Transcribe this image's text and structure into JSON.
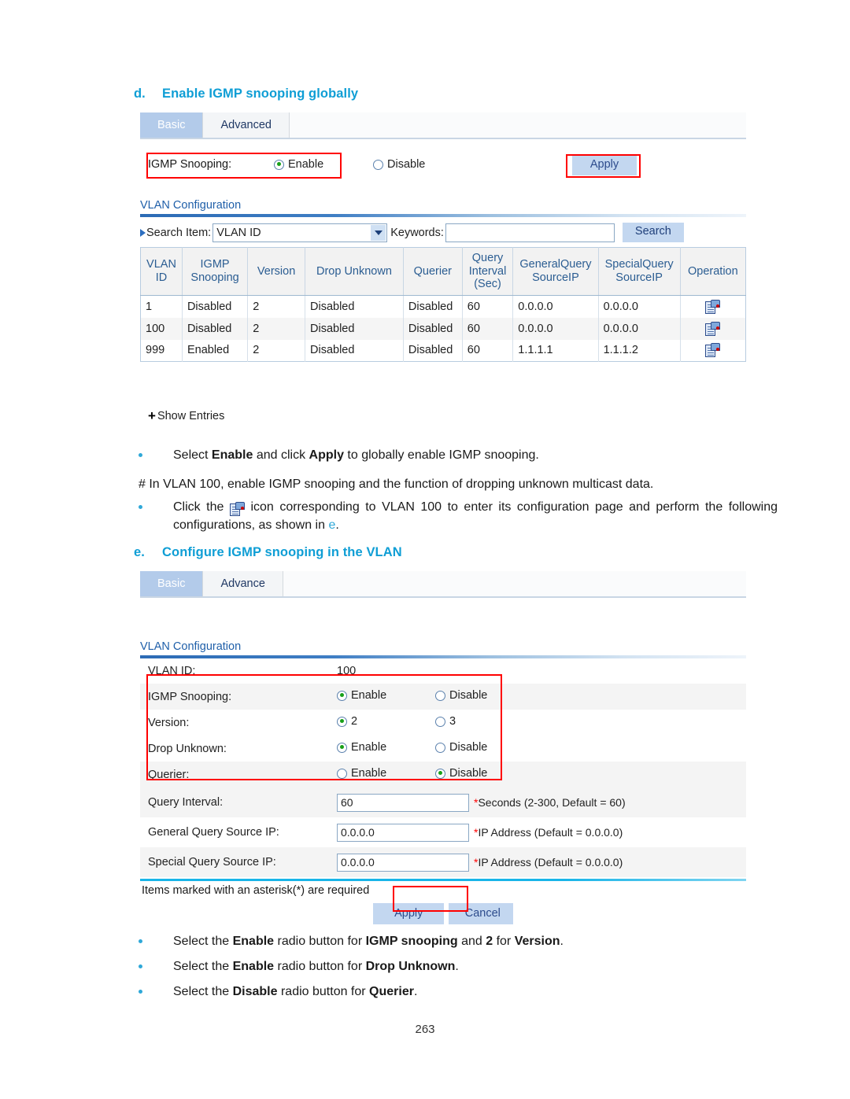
{
  "section_d": {
    "letter": "d.",
    "title": "Enable IGMP snooping globally"
  },
  "panel1": {
    "tabs": [
      {
        "label": "Basic",
        "active": true
      },
      {
        "label": "Advanced",
        "active": false
      }
    ],
    "igmp_snooping_label": "IGMP Snooping:",
    "enable_label": "Enable",
    "disable_label": "Disable",
    "apply_label": "Apply",
    "section_title": "VLAN Configuration",
    "search": {
      "search_item_label": "Search Item:",
      "selected_option": "VLAN ID",
      "options": [
        "VLAN ID"
      ],
      "keywords_label": "Keywords:",
      "keywords_value": "",
      "search_button": "Search"
    },
    "table": {
      "headers": [
        "VLAN ID",
        "IGMP Snooping",
        "Version",
        "Drop Unknown",
        "Querier",
        "Query Interval (Sec)",
        "GeneralQuery SourceIP",
        "SpecialQuery SourceIP",
        "Operation"
      ],
      "rows": [
        {
          "vlan_id": "1",
          "igmp_snooping": "Disabled",
          "version": "2",
          "drop_unknown": "Disabled",
          "querier": "Disabled",
          "query_interval": "60",
          "general_query_source_ip": "0.0.0.0",
          "special_query_source_ip": "0.0.0.0",
          "operation_icon": "config-icon"
        },
        {
          "vlan_id": "100",
          "igmp_snooping": "Disabled",
          "version": "2",
          "drop_unknown": "Disabled",
          "querier": "Disabled",
          "query_interval": "60",
          "general_query_source_ip": "0.0.0.0",
          "special_query_source_ip": "0.0.0.0",
          "operation_icon": "config-icon"
        },
        {
          "vlan_id": "999",
          "igmp_snooping": "Enabled",
          "version": "2",
          "drop_unknown": "Disabled",
          "querier": "Disabled",
          "query_interval": "60",
          "general_query_source_ip": "1.1.1.1",
          "special_query_source_ip": "1.1.1.2",
          "operation_icon": "config-icon"
        }
      ]
    },
    "show_entries": "Show Entries"
  },
  "body": {
    "bullet1_html": "Select <b>Enable</b> and click <b>Apply</b> to globally enable IGMP snooping.",
    "para1": "# In VLAN 100, enable IGMP snooping and the function of dropping unknown multicast data.",
    "bullet2_pre": "Click the",
    "bullet2_post_html": "icon corresponding to VLAN 100 to enter its configuration page and perform the following configurations, as shown in <span class=\"xref\">e</span>."
  },
  "section_e": {
    "letter": "e.",
    "title": "Configure IGMP snooping in the VLAN"
  },
  "panel2": {
    "tabs": [
      {
        "label": "Basic",
        "active": true
      },
      {
        "label": "Advance",
        "active": false
      }
    ],
    "section_title": "VLAN Configuration",
    "fields": [
      {
        "label": "VLAN ID:",
        "value": "100",
        "type": "text"
      },
      {
        "label": "IGMP Snooping:",
        "type": "radio",
        "options": [
          "Enable",
          "Disable"
        ],
        "selected": "Enable"
      },
      {
        "label": "Version:",
        "type": "radio",
        "options": [
          "2",
          "3"
        ],
        "selected": "2"
      },
      {
        "label": "Drop Unknown:",
        "type": "radio",
        "options": [
          "Enable",
          "Disable"
        ],
        "selected": "Enable"
      },
      {
        "label": "Querier:",
        "type": "radio",
        "options": [
          "Enable",
          "Disable"
        ],
        "selected": "Disable"
      },
      {
        "label": "Query Interval:",
        "type": "input",
        "value": "60",
        "hint": "Seconds (2-300, Default = 60)"
      },
      {
        "label": "General Query Source IP:",
        "type": "input",
        "value": "0.0.0.0",
        "hint": "IP Address (Default = 0.0.0.0)"
      },
      {
        "label": "Special Query Source IP:",
        "type": "input",
        "value": "0.0.0.0",
        "hint": "IP Address (Default = 0.0.0.0)"
      }
    ],
    "required_note": "Items marked with an asterisk(*) are required",
    "apply_label": "Apply",
    "cancel_label": "Cancel"
  },
  "body2": {
    "bullet1_html": "Select the <b>Enable</b> radio button for <b>IGMP snooping</b> and <b>2</b> for <b>Version</b>.",
    "bullet2_html": "Select the <b>Enable</b> radio button for <b>Drop Unknown</b>.",
    "bullet3_html": "Select the <b>Disable</b> radio button for <b>Querier</b>."
  },
  "footer": {
    "page_number": "263"
  },
  "colors": {
    "heading_blue": "#0f9ed5",
    "tab_active": "#b3cbea",
    "button_blue": "#c3d7f0",
    "annotation_red": "#ff0000",
    "table_header_text": "#2b5d92",
    "radio_selected": "#18a018"
  }
}
